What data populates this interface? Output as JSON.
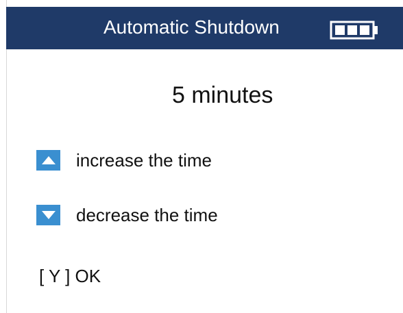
{
  "header": {
    "title": "Automatic Shutdown",
    "battery_icon": "battery-full-icon",
    "battery_level": 1.0,
    "background": "#1f3a68"
  },
  "setting": {
    "value": "5 minutes"
  },
  "controls": {
    "increase_icon": "up-arrow-key-icon",
    "increase_label": "increase the time",
    "decrease_icon": "down-arrow-key-icon",
    "decrease_label": "decrease the time",
    "key_color": "#3a8fd0"
  },
  "confirm": {
    "label": "[ Y ] OK"
  }
}
